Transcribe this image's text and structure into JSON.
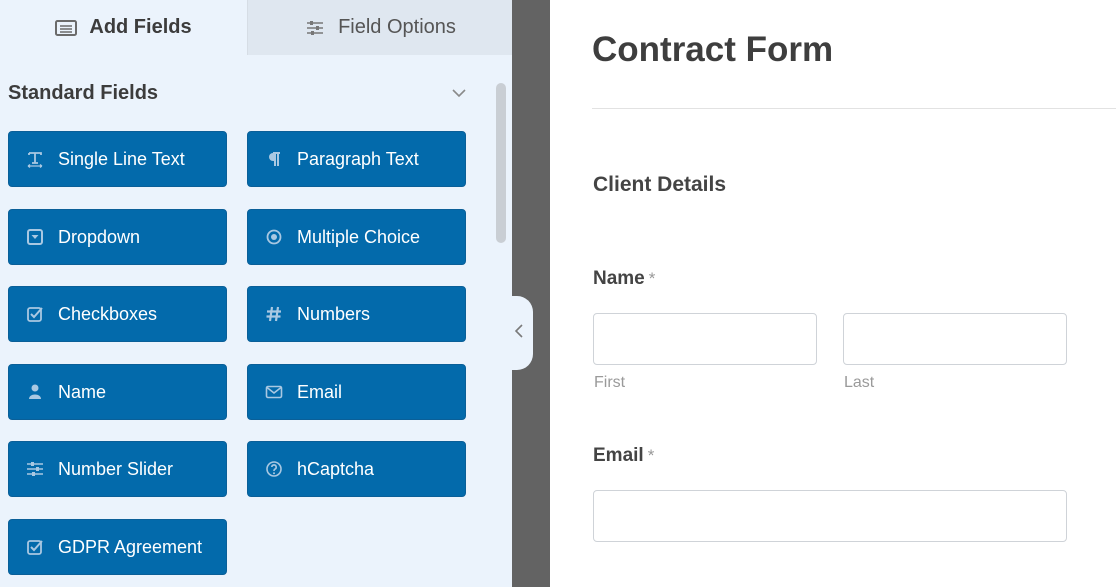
{
  "tabs": [
    {
      "label": "Add Fields",
      "icon": "list-icon",
      "active": true
    },
    {
      "label": "Field Options",
      "icon": "sliders-icon",
      "active": false
    }
  ],
  "sidebar": {
    "section_title": "Standard Fields",
    "fields": [
      {
        "label": "Single Line Text",
        "icon": "text-icon"
      },
      {
        "label": "Paragraph Text",
        "icon": "paragraph-icon"
      },
      {
        "label": "Dropdown",
        "icon": "dropdown-icon"
      },
      {
        "label": "Multiple Choice",
        "icon": "radio-icon"
      },
      {
        "label": "Checkboxes",
        "icon": "checkbox-icon"
      },
      {
        "label": "Numbers",
        "icon": "hash-icon"
      },
      {
        "label": "Name",
        "icon": "user-icon"
      },
      {
        "label": "Email",
        "icon": "envelope-icon"
      },
      {
        "label": "Number Slider",
        "icon": "sliders-icon"
      },
      {
        "label": "hCaptcha",
        "icon": "question-circle-icon"
      },
      {
        "label": "GDPR Agreement",
        "icon": "checkbox-icon"
      }
    ]
  },
  "form": {
    "title": "Contract Form",
    "section": "Client Details",
    "name_field": {
      "label": "Name",
      "required_marker": "*",
      "first_value": "",
      "last_value": "",
      "first_sublabel": "First",
      "last_sublabel": "Last"
    },
    "email_field": {
      "label": "Email",
      "required_marker": "*",
      "value": ""
    }
  },
  "colors": {
    "accent": "#036aab",
    "panel_bg": "#ebf3fc",
    "divider": "#636363"
  }
}
